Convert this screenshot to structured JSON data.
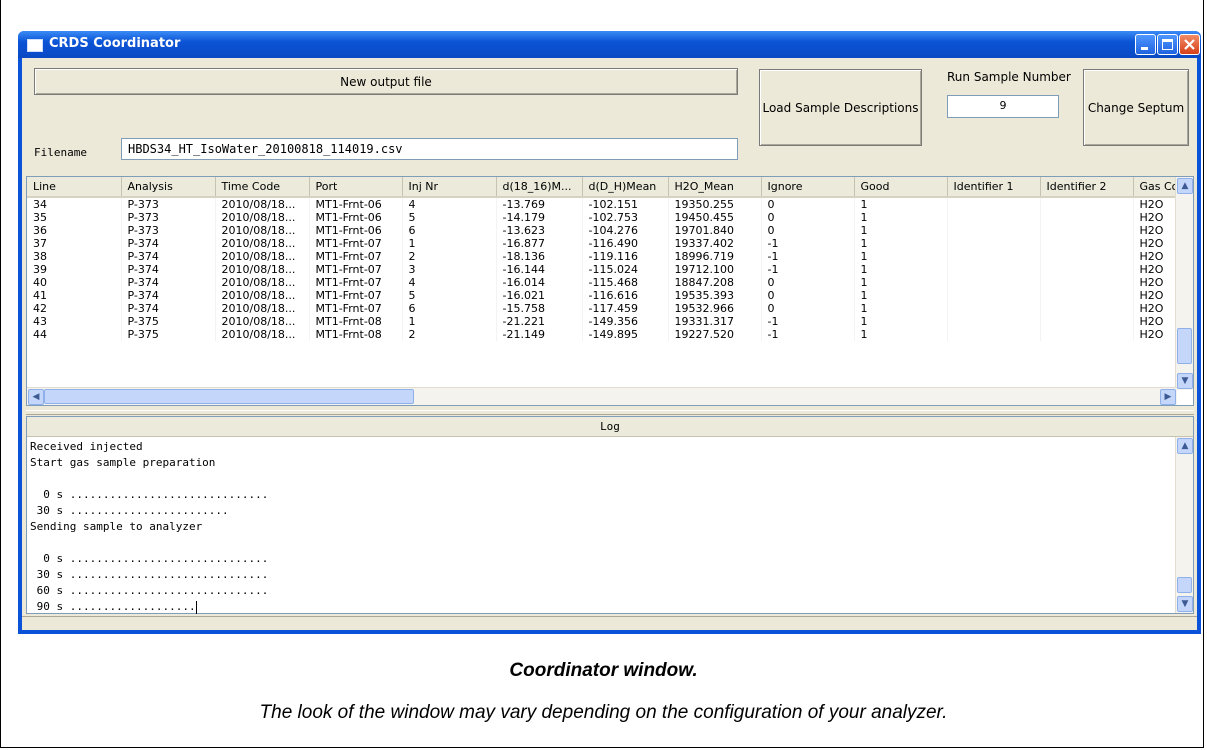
{
  "window": {
    "title": "CRDS Coordinator"
  },
  "toolbar": {
    "new_output_file_label": "New output file",
    "filename_label": "Filename",
    "filename_value": "HBDS34_HT_IsoWater_20100818_114019.csv",
    "load_descriptions_label": "Load Sample Descriptions",
    "run_sample_label": "Run Sample Number",
    "run_sample_value": "9",
    "change_septum_label": "Change Septum"
  },
  "table": {
    "headers": [
      "Line",
      "Analysis",
      "Time Code",
      "Port",
      "Inj Nr",
      "d(18_16)M...",
      "d(D_H)Mean",
      "H2O_Mean",
      "Ignore",
      "Good",
      "Identifier 1",
      "Identifier 2",
      "Gas Co"
    ],
    "rows": [
      [
        "34",
        "P-373",
        "2010/08/18...",
        "MT1-Frnt-06",
        "4",
        "-13.769",
        "-102.151",
        "19350.255",
        "0",
        "1",
        "",
        "",
        "H2O"
      ],
      [
        "35",
        "P-373",
        "2010/08/18...",
        "MT1-Frnt-06",
        "5",
        "-14.179",
        "-102.753",
        "19450.455",
        "0",
        "1",
        "",
        "",
        "H2O"
      ],
      [
        "36",
        "P-373",
        "2010/08/18...",
        "MT1-Frnt-06",
        "6",
        "-13.623",
        "-104.276",
        "19701.840",
        "0",
        "1",
        "",
        "",
        "H2O"
      ],
      [
        "37",
        "P-374",
        "2010/08/18...",
        "MT1-Frnt-07",
        "1",
        "-16.877",
        "-116.490",
        "19337.402",
        "-1",
        "1",
        "",
        "",
        "H2O"
      ],
      [
        "38",
        "P-374",
        "2010/08/18...",
        "MT1-Frnt-07",
        "2",
        "-18.136",
        "-119.116",
        "18996.719",
        "-1",
        "1",
        "",
        "",
        "H2O"
      ],
      [
        "39",
        "P-374",
        "2010/08/18...",
        "MT1-Frnt-07",
        "3",
        "-16.144",
        "-115.024",
        "19712.100",
        "-1",
        "1",
        "",
        "",
        "H2O"
      ],
      [
        "40",
        "P-374",
        "2010/08/18...",
        "MT1-Frnt-07",
        "4",
        "-16.014",
        "-115.468",
        "18847.208",
        "0",
        "1",
        "",
        "",
        "H2O"
      ],
      [
        "41",
        "P-374",
        "2010/08/18...",
        "MT1-Frnt-07",
        "5",
        "-16.021",
        "-116.616",
        "19535.393",
        "0",
        "1",
        "",
        "",
        "H2O"
      ],
      [
        "42",
        "P-374",
        "2010/08/18...",
        "MT1-Frnt-07",
        "6",
        "-15.758",
        "-117.459",
        "19532.966",
        "0",
        "1",
        "",
        "",
        "H2O"
      ],
      [
        "43",
        "P-375",
        "2010/08/18...",
        "MT1-Frnt-08",
        "1",
        "-21.221",
        "-149.356",
        "19331.317",
        "-1",
        "1",
        "",
        "",
        "H2O"
      ],
      [
        "44",
        "P-375",
        "2010/08/18...",
        "MT1-Frnt-08",
        "2",
        "-21.149",
        "-149.895",
        "19227.520",
        "-1",
        "1",
        "",
        "",
        "H2O"
      ]
    ]
  },
  "log": {
    "header": "Log",
    "lines": [
      "Received injected",
      "Start gas sample preparation",
      "",
      "  0 s ..............................",
      " 30 s ........................",
      "Sending sample to analyzer",
      "",
      "  0 s ..............................",
      " 30 s ..............................",
      " 60 s ..............................",
      " 90 s ..................."
    ]
  },
  "captions": {
    "title": "Coordinator window.",
    "note": "The look of the window may vary depending on the configuration of your analyzer."
  },
  "icons": [
    "app-icon",
    "minimize-icon",
    "maximize-icon",
    "close-icon",
    "scroll-up-icon",
    "scroll-down-icon",
    "scroll-left-icon",
    "scroll-right-icon"
  ]
}
